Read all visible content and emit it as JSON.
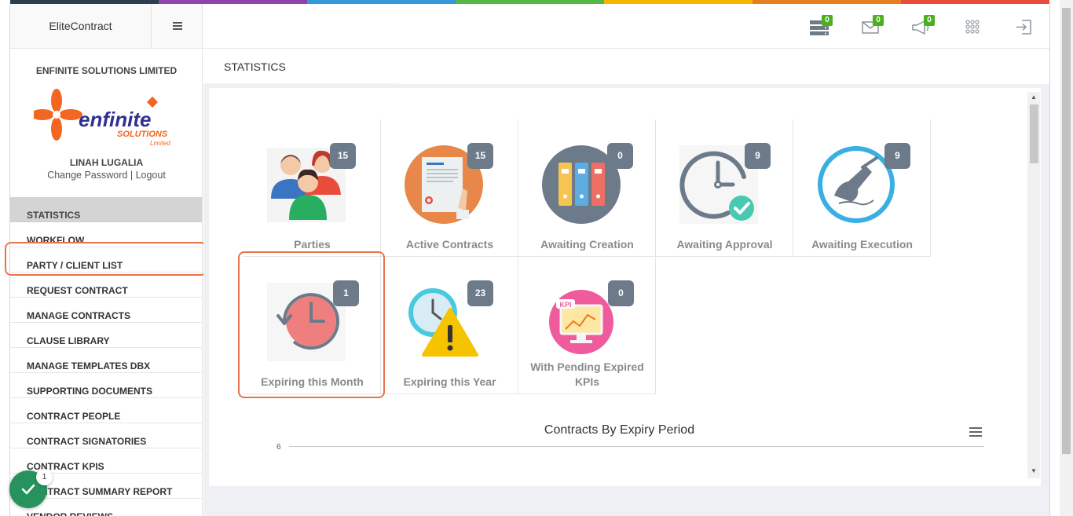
{
  "colors": {
    "accent": "#e8744a",
    "badge": "#6c7a89",
    "notify": "#4caf1f",
    "fab": "#26935f"
  },
  "colorbar": [
    "#2c3e50",
    "#8e44ad",
    "#3498db",
    "#54b948",
    "#f5b700",
    "#e67e22",
    "#e74c3c"
  ],
  "sidebar": {
    "brand": "EliteContract",
    "company": "ENFINITE SOLUTIONS LIMITED",
    "logo_text": "enfinite",
    "logo_sub1": "SOLUTIONS",
    "logo_sub2": "Limited",
    "user": "LINAH LUGALIA",
    "change_password": "Change Password",
    "separator": "|",
    "logout": "Logout",
    "items": [
      {
        "label": "STATISTICS"
      },
      {
        "label": "WORKFLOW"
      },
      {
        "label": "PARTY / CLIENT LIST"
      },
      {
        "label": "REQUEST CONTRACT"
      },
      {
        "label": "MANAGE CONTRACTS"
      },
      {
        "label": "CLAUSE LIBRARY"
      },
      {
        "label": "MANAGE TEMPLATES DBX"
      },
      {
        "label": "SUPPORTING DOCUMENTS"
      },
      {
        "label": "CONTRACT PEOPLE"
      },
      {
        "label": "CONTRACT SIGNATORIES"
      },
      {
        "label": "CONTRACT KPIS"
      },
      {
        "label": "CONTRACT SUMMARY REPORT"
      },
      {
        "label": "VENDOR REVIEWS"
      }
    ],
    "fab_badge": "1"
  },
  "topbar": {
    "icons": [
      {
        "name": "tasks",
        "badge": "0"
      },
      {
        "name": "messages",
        "badge": "0"
      },
      {
        "name": "announcements",
        "badge": "0"
      },
      {
        "name": "apps"
      },
      {
        "name": "logout"
      }
    ]
  },
  "main": {
    "title": "STATISTICS",
    "tiles": [
      {
        "label": "Parties",
        "count": "15"
      },
      {
        "label": "Active Contracts",
        "count": "15"
      },
      {
        "label": "Awaiting Creation",
        "count": "0"
      },
      {
        "label": "Awaiting Approval",
        "count": "9"
      },
      {
        "label": "Awaiting Execution",
        "count": "9"
      },
      {
        "label": "Expiring this Month",
        "count": "1"
      },
      {
        "label": "Expiring this Year",
        "count": "23"
      },
      {
        "label": "With Pending Expired KPIs",
        "count": "0"
      }
    ],
    "kpi_text": "KPI",
    "chart": {
      "title": "Contracts By Expiry Period",
      "ytick": "6"
    }
  }
}
